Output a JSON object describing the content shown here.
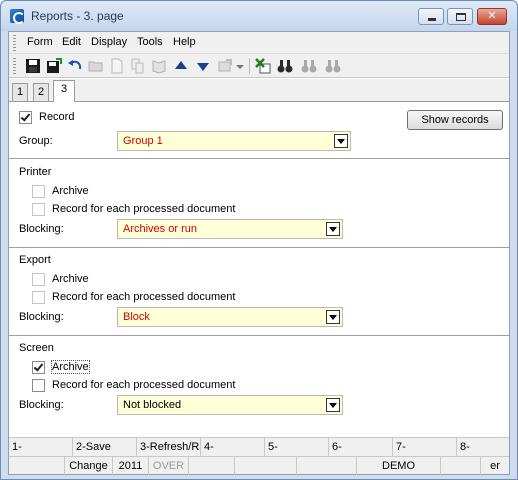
{
  "window": {
    "title": "Reports - 3. page"
  },
  "menu": [
    "Form",
    "Edit",
    "Display",
    "Tools",
    "Help"
  ],
  "toolbar_icons": [
    "save-icon",
    "save-as-icon",
    "undo-icon",
    "open-folder-icon",
    "new-document-icon",
    "copy-document-icon",
    "book-icon",
    "arrow-up-icon",
    "arrow-down-icon",
    "options-icon",
    "dropdown-arrow-icon",
    "excel-export-icon",
    "binoculars-icon",
    "binoculars-prev-icon",
    "binoculars-next-icon"
  ],
  "tabs": [
    "1",
    "2",
    "3"
  ],
  "record": {
    "checkbox_label": "Record",
    "checked": true,
    "show_records_label": "Show records",
    "group_label": "Group:",
    "group_value": "Group 1"
  },
  "printer": {
    "title": "Printer",
    "archive_label": "Archive",
    "archive_checked": false,
    "record_each_label": "Record for each processed document",
    "record_each_checked": false,
    "blocking_label": "Blocking:",
    "blocking_value": "Archives or run"
  },
  "export": {
    "title": "Export",
    "archive_label": "Archive",
    "archive_checked": false,
    "record_each_label": "Record for each processed document",
    "record_each_checked": false,
    "blocking_label": "Blocking:",
    "blocking_value": "Block"
  },
  "screen": {
    "title": "Screen",
    "archive_label": "Archive",
    "archive_checked": true,
    "record_each_label": "Record for each processed document",
    "record_each_checked": false,
    "blocking_label": "Blocking:",
    "blocking_value": "Not blocked"
  },
  "fkeys": [
    "1-",
    "2-Save",
    "3-Refresh/R",
    "4-",
    "5-",
    "6-",
    "7-",
    "8-"
  ],
  "status": {
    "mode": "Change",
    "year": "2011",
    "overwrite": "OVER",
    "database": "DEMO",
    "lang": "er"
  },
  "colors": {
    "value_red": "#d00000",
    "field_bg": "#ffffd8",
    "title_text": "#1e395b"
  }
}
